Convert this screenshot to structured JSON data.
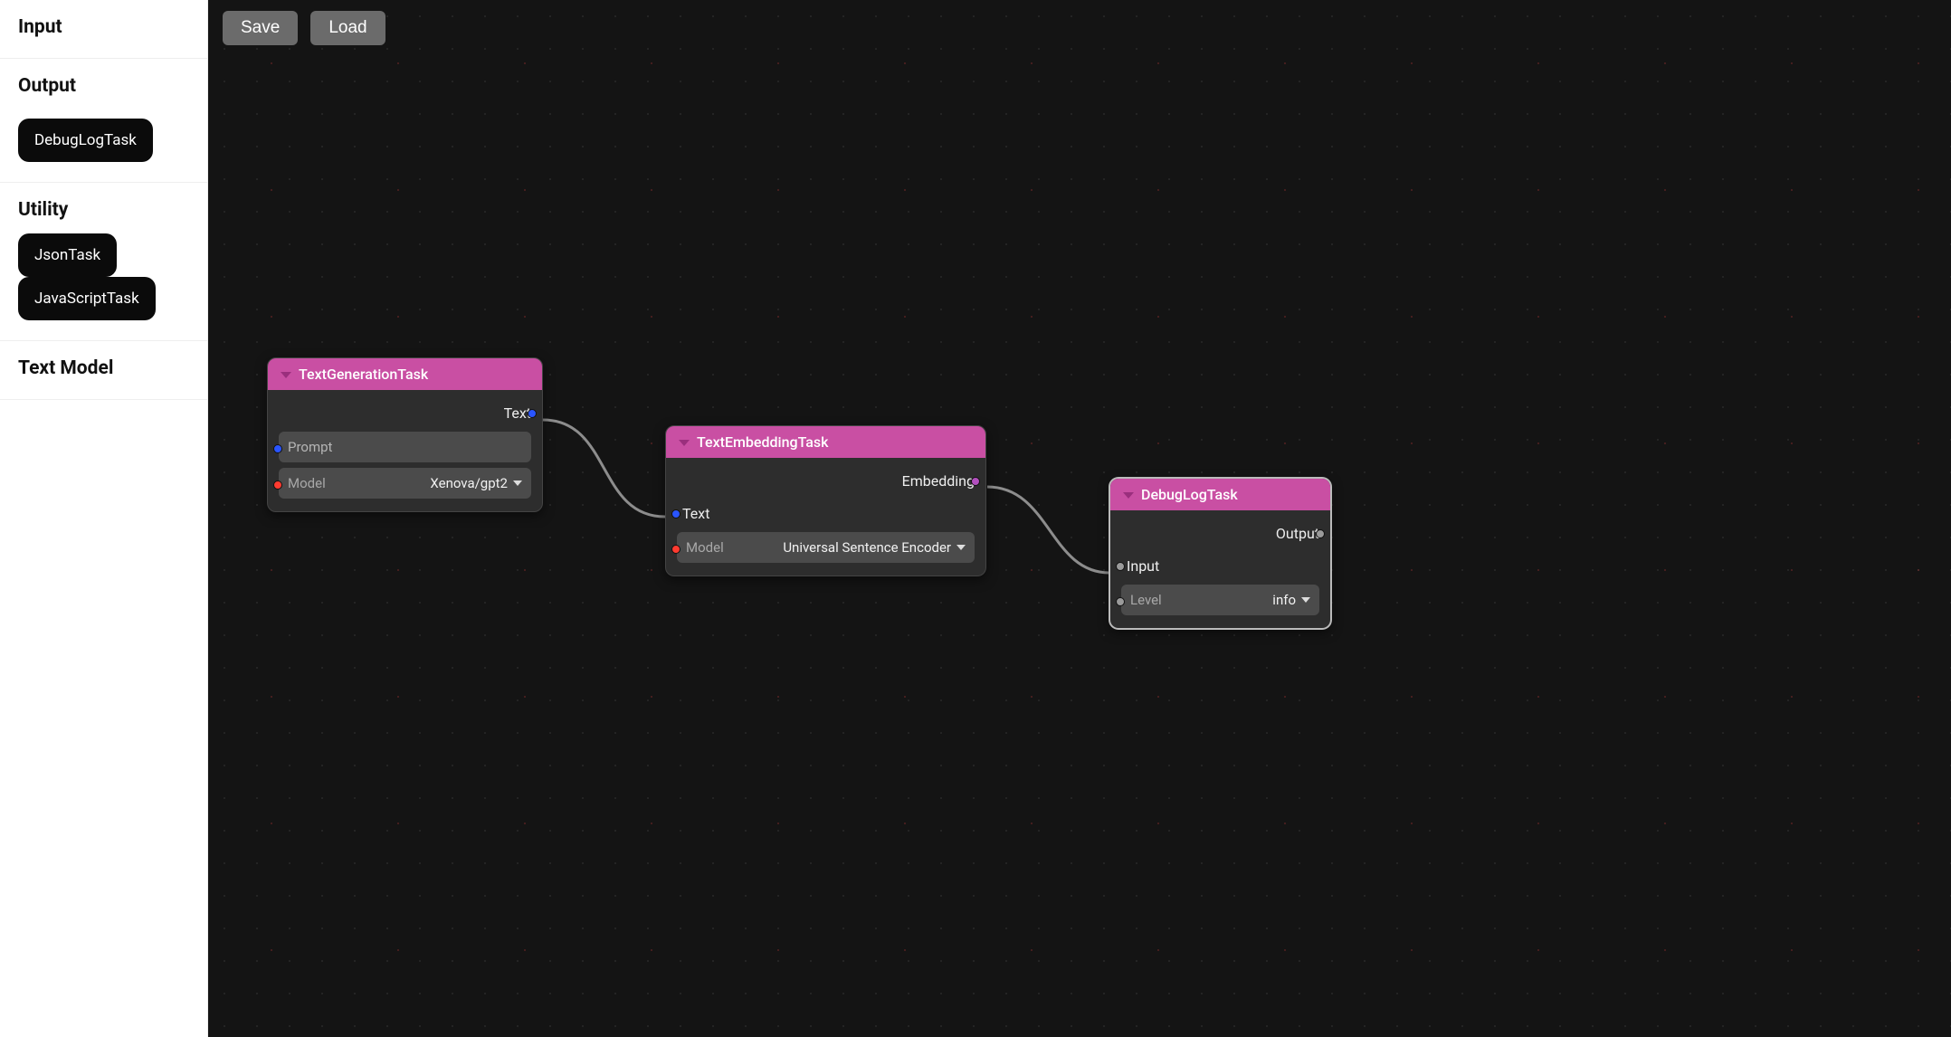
{
  "sidebar": {
    "sections": [
      {
        "title": "Input",
        "items": []
      },
      {
        "title": "Output",
        "items": [
          "DebugLogTask"
        ]
      },
      {
        "title": "Utility",
        "items": [
          "JsonTask",
          "JavaScriptTask"
        ]
      },
      {
        "title": "Text Model",
        "items": []
      }
    ]
  },
  "toolbar": {
    "save": "Save",
    "load": "Load"
  },
  "nodes": {
    "gen": {
      "title": "TextGenerationTask",
      "outputs": {
        "text": "Text"
      },
      "inputs": {
        "prompt_label": "Prompt",
        "model_label": "Model",
        "model_value": "Xenova/gpt2"
      }
    },
    "emb": {
      "title": "TextEmbeddingTask",
      "outputs": {
        "embedding": "Embedding"
      },
      "inputs": {
        "text_label": "Text",
        "model_label": "Model",
        "model_value": "Universal Sentence Encoder"
      }
    },
    "dbg": {
      "title": "DebugLogTask",
      "outputs": {
        "output": "Output"
      },
      "inputs": {
        "input_label": "Input",
        "level_label": "Level",
        "level_value": "info"
      }
    }
  }
}
